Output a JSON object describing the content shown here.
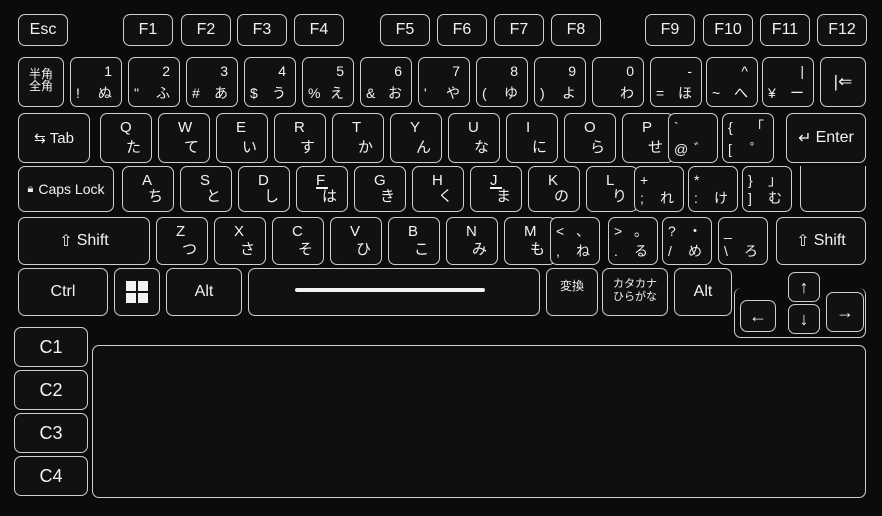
{
  "function_row": [
    "Esc",
    "F1",
    "F2",
    "F3",
    "F4",
    "F5",
    "F6",
    "F7",
    "F8",
    "F9",
    "F10",
    "F11",
    "F12"
  ],
  "number_row": [
    {
      "zen": "半角\n全角"
    },
    {
      "top_left": "",
      "top_right": "1",
      "bottom_left": "!",
      "bottom_right": "ぬ"
    },
    {
      "top_left": "",
      "top_right": "2",
      "bottom_left": "\"",
      "bottom_right": "ふ"
    },
    {
      "top_left": "",
      "top_right": "3",
      "bottom_left": "#",
      "bottom_right": "あ"
    },
    {
      "top_left": "",
      "top_right": "4",
      "bottom_left": "$",
      "bottom_right": "う"
    },
    {
      "top_left": "",
      "top_right": "5",
      "bottom_left": "%",
      "bottom_right": "え"
    },
    {
      "top_left": "",
      "top_right": "6",
      "bottom_left": "&",
      "bottom_right": "お"
    },
    {
      "top_left": "",
      "top_right": "7",
      "bottom_left": "'",
      "bottom_right": "や"
    },
    {
      "top_left": "",
      "top_right": "8",
      "bottom_left": "(",
      "bottom_right": "ゆ"
    },
    {
      "top_left": "",
      "top_right": "9",
      "bottom_left": ")",
      "bottom_right": "よ"
    },
    {
      "top_left": "",
      "top_right": "0",
      "bottom_left": "",
      "bottom_right": "わ"
    },
    {
      "top_left": "",
      "top_right": "-",
      "bottom_left": "=",
      "bottom_right": "ほ"
    },
    {
      "top_left": "",
      "top_right": "^",
      "bottom_left": "~",
      "bottom_right": "へ"
    },
    {
      "top_left": "",
      "top_right": "|",
      "bottom_left": "¥",
      "bottom_right": "ー"
    },
    {
      "label": "|⇐"
    }
  ],
  "tab_row": {
    "tab": "Tab",
    "keys": [
      {
        "letter": "Q",
        "kana": "た"
      },
      {
        "letter": "W",
        "kana": "て"
      },
      {
        "letter": "E",
        "kana": "い"
      },
      {
        "letter": "R",
        "kana": "す"
      },
      {
        "letter": "T",
        "kana": "か"
      },
      {
        "letter": "Y",
        "kana": "ん"
      },
      {
        "letter": "U",
        "kana": "な"
      },
      {
        "letter": "I",
        "kana": "に"
      },
      {
        "letter": "O",
        "kana": "ら"
      },
      {
        "letter": "P",
        "kana": "せ"
      },
      {
        "top_left": "`",
        "bottom_left": "@",
        "bottom_right": "゛"
      },
      {
        "top_left": "{",
        "top_right": "「",
        "bottom_left": "[",
        "bottom_right": "゜"
      }
    ],
    "enter": "Enter"
  },
  "caps_row": {
    "caps": "Caps Lock",
    "keys": [
      {
        "letter": "A",
        "kana": "ち"
      },
      {
        "letter": "S",
        "kana": "と"
      },
      {
        "letter": "D",
        "kana": "し"
      },
      {
        "letter": "F",
        "kana": "は"
      },
      {
        "letter": "G",
        "kana": "き"
      },
      {
        "letter": "H",
        "kana": "く"
      },
      {
        "letter": "J",
        "kana": "ま"
      },
      {
        "letter": "K",
        "kana": "の"
      },
      {
        "letter": "L",
        "kana": "り"
      },
      {
        "top_left": "+",
        "bottom_left": ";",
        "bottom_right": "れ"
      },
      {
        "top_left": "*",
        "bottom_left": ":",
        "bottom_right": "け"
      },
      {
        "top_left": "}",
        "top_right": "」",
        "bottom_left": "]",
        "bottom_right": "む"
      }
    ]
  },
  "shift_row": {
    "left_shift": "Shift",
    "keys": [
      {
        "letter": "Z",
        "kana": "つ"
      },
      {
        "letter": "X",
        "kana": "さ"
      },
      {
        "letter": "C",
        "kana": "そ"
      },
      {
        "letter": "V",
        "kana": "ひ"
      },
      {
        "letter": "B",
        "kana": "こ"
      },
      {
        "letter": "N",
        "kana": "み"
      },
      {
        "letter": "M",
        "kana": "も"
      },
      {
        "top_left": "<",
        "top_right": "、",
        "bottom_left": ",",
        "bottom_right": "ね"
      },
      {
        "top_left": ">",
        "top_right": "。",
        "bottom_left": ".",
        "bottom_right": "る"
      },
      {
        "top_left": "?",
        "top_right": "・",
        "bottom_left": "/",
        "bottom_right": "め"
      },
      {
        "top_left": "_",
        "top_right": "",
        "bottom_left": "\\",
        "bottom_right": "ろ"
      }
    ],
    "right_shift": "Shift"
  },
  "bottom_row": {
    "ctrl": "Ctrl",
    "alt_left": "Alt",
    "henkan": "変換",
    "kana_top": "カタカナ",
    "kana_bottom": "ひらがな",
    "alt_right": "Alt"
  },
  "arrows": {
    "up": "↑",
    "left": "←",
    "down": "↓",
    "right": "→"
  },
  "side_keys": [
    "C1",
    "C2",
    "C3",
    "C4"
  ]
}
